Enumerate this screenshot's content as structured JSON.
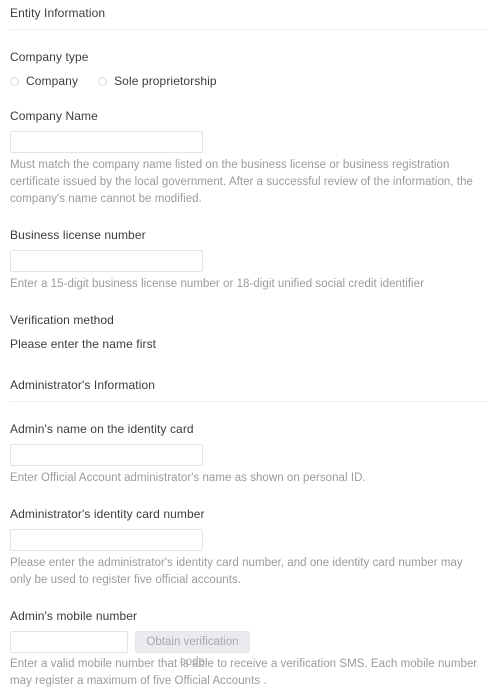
{
  "sections": [
    {
      "id": "entity",
      "title": "Entity Information"
    },
    {
      "id": "administrator",
      "title": "Administrator's Information"
    }
  ],
  "entity": {
    "company_type": {
      "label": "Company type",
      "options": [
        {
          "label": "Company",
          "selected": false
        },
        {
          "label": "Sole proprietorship",
          "selected": false
        }
      ]
    },
    "company_name": {
      "label": "Company Name",
      "value": "",
      "placeholder": "",
      "hint": "Must match the company name listed on the business license or business registration certificate issued by the local government. After a successful review of the information, the company's name cannot be modified."
    },
    "business_license": {
      "label": "Business license number",
      "value": "",
      "placeholder": "",
      "hint": "Enter a 15-digit business license number or 18-digit unified social credit identifier"
    },
    "verification_method": {
      "label": "Verification method",
      "message": "Please enter the name first"
    }
  },
  "administrator": {
    "admin_name": {
      "label": "Admin's name on the identity card",
      "value": "",
      "placeholder": "",
      "hint": "Enter Official Account administrator's name as shown on personal ID."
    },
    "identity_card": {
      "label": "Administrator's identity card number",
      "value": "",
      "placeholder": "",
      "hint": "Please enter the administrator's identity card number, and one identity card number may only be used to register five official accounts."
    },
    "mobile": {
      "label": "Admin's mobile number",
      "value": "",
      "placeholder": "",
      "button_label": "Obtain verification code",
      "hint": "Enter a valid mobile number that is able to receive a verification SMS. Each mobile number may register a maximum of five Official Accounts ."
    }
  },
  "colors": {
    "text": "#3c3c3c",
    "hint": "#9b9b9b",
    "divider": "#ededed",
    "input_border": "#e3e3e6",
    "button_bg": "#ebebef",
    "button_text": "#a8a8ae"
  }
}
